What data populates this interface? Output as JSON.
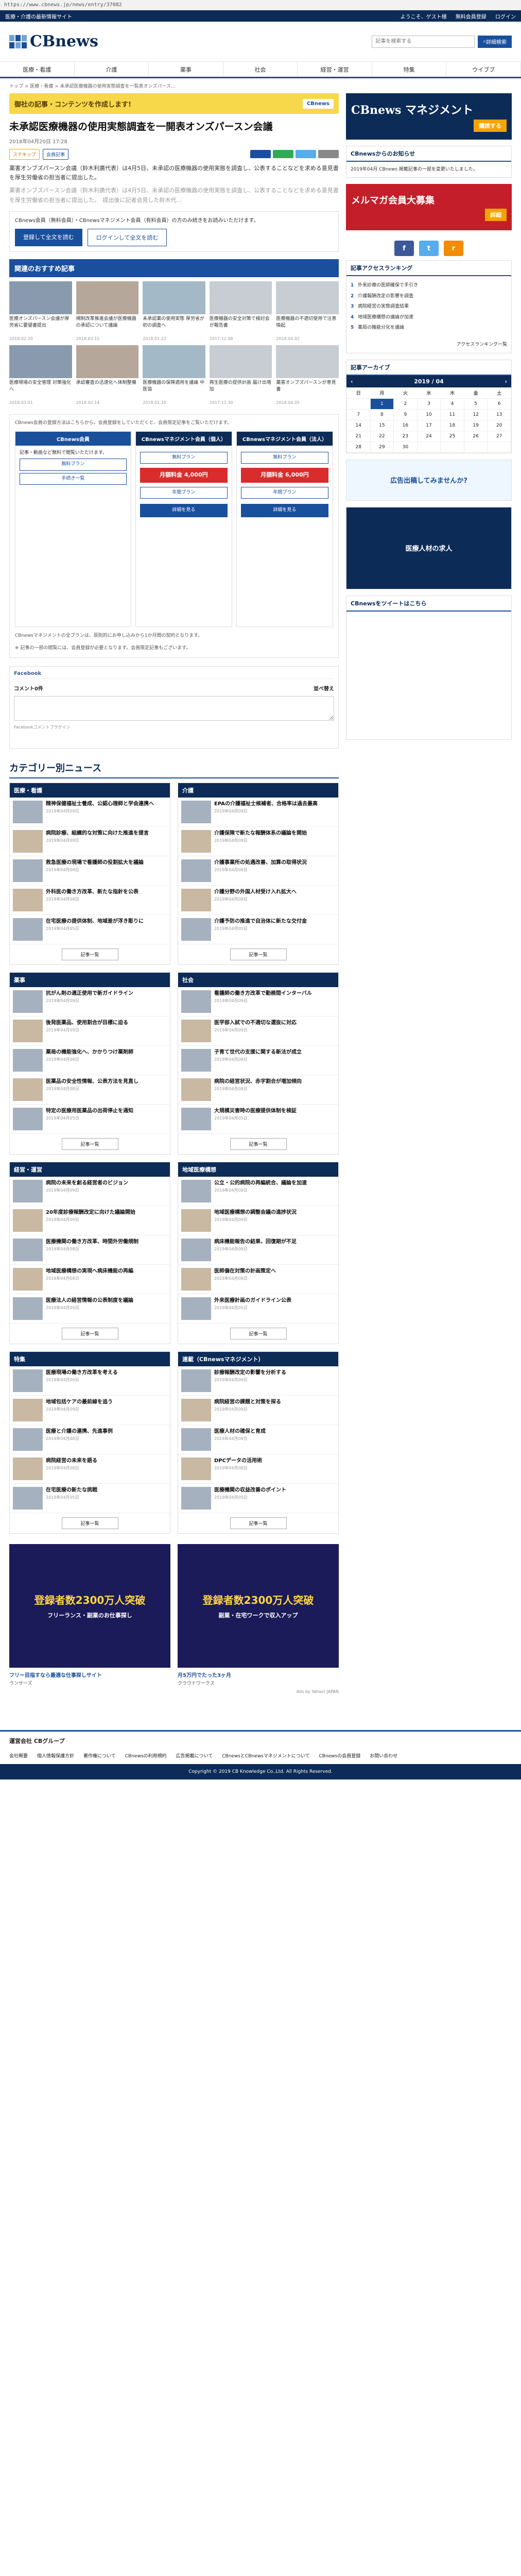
{
  "browser": {
    "url": "https://www.cbnews.jp/news/entry/37082"
  },
  "topbar": {
    "left": "医療・介護の最新情報サイト",
    "welcome": "ようこそ、ゲスト様",
    "links": [
      "無料会員登録",
      "ログイン"
    ]
  },
  "header": {
    "logo": "CBnews",
    "search_placeholder": "記事を検索する",
    "search_button": "詳細検索"
  },
  "nav": [
    "医療・看護",
    "介護",
    "薬事",
    "社会",
    "経営・運営",
    "特集",
    "ウイブブ"
  ],
  "breadcrumb": "トップ > 医療・看護 > 未承認医療機器の使用実態調査を一覧表オンズパース…",
  "article": {
    "promo": "御社の記事・コンテンツを作成します!",
    "promo_badge": "CBnews",
    "title": "未承認医療機器の使用実態調査を一開表オンズパースン会議",
    "date": "2018年04月20日 17:28",
    "tags": [
      "ステキップ",
      "会員記事"
    ],
    "lead1": "薬害オンブズパースン会議（鈴木利廣代表）は4月5日、未承認の医療機器の使用実態を調査し、公表することなどを求める意見書を厚生労働省の担当者に提出した。",
    "lead2": "薬害オンブズパースン会議（鈴木利廣代表）は4月5日、未承認の医療機器の使用実態を調査し、公表することなどを求める意見書を厚生労働省の担当者に提出した。　提出後に記者会見した鈴木代…",
    "login_note": "CBnews会員（無料会員）・CBnewsマネジメント会員（有料会員）の方のみ続きをお読みいただけます。",
    "login_btn1": "登録して全文を読む",
    "login_btn2": "ログインして全文を読む"
  },
  "reco": {
    "heading": "関連のおすすめ記事",
    "items": [
      {
        "cap": "医療オンズパースン会議が厚労省に要望書提出",
        "date": "2018.02.20"
      },
      {
        "cap": "規制改革推進会議が医療機器の承認について議論",
        "date": "2018.03.15"
      },
      {
        "cap": "未承認薬の使用実態 厚労省が初の調査へ",
        "date": "2018.01.22"
      },
      {
        "cap": "医療機器の安全対策で検討会が報告書",
        "date": "2017.12.08"
      },
      {
        "cap": "医療機器の不適切使用で注意喚起",
        "date": "2018.04.02"
      },
      {
        "cap": "医療現場の安全管理 対策強化へ",
        "date": "2018.03.01"
      },
      {
        "cap": "承認審査の迅速化へ体制整備",
        "date": "2018.02.14"
      },
      {
        "cap": "医療機器の保険適用を議論 中医協",
        "date": "2018.01.10"
      },
      {
        "cap": "再生医療の提供計画 届け出増加",
        "date": "2017.11.30"
      },
      {
        "cap": "薬害オンブズパースンが意見書",
        "date": "2018.04.05"
      }
    ]
  },
  "plans": {
    "note": "CBnews会員の登録方法はこちらから。会員登録をしていただくと、会員限定記事をご覧いただけます。",
    "col1": {
      "head": "CBnews会員",
      "body": "記事・動画など無料で閲覧いただけます。",
      "labels": [
        "無料プラン",
        "手続き一覧"
      ]
    },
    "col2": {
      "head": "CBnewsマネジメント会員（個人）",
      "price": "月額料金 4,000円",
      "labels": [
        "無料プラン",
        "年間プラン"
      ],
      "cta": "詳細を見る"
    },
    "col3": {
      "head": "CBnewsマネジメント会員（法人）",
      "price": "月額料金 6,000円",
      "labels": [
        "無料プラン",
        "年間プラン"
      ],
      "cta": "詳細を見る"
    },
    "disclaim1": "CBnewsマネジメントの全プランは、原則的にお申し込みから1か月間の契約となります。",
    "disclaim2": "※ 記事の一部の閲覧には、会員登録が必要となります。会員限定記事もございます。"
  },
  "facebook": {
    "label": "Facebook",
    "count": "コメント0件",
    "sort": "並べ替え",
    "plugin": "Facebookコメントプラグイン"
  },
  "categories": {
    "heading": "カテゴリー別ニュース",
    "more": "記事一覧",
    "boxes": [
      {
        "name": "医療・看護",
        "items": [
          {
            "t": "精神保健福祉士養成、公認心理師と学会連携へ",
            "d": "2019年04月09日"
          },
          {
            "t": "病院診療、組織的な対策に向けた推進を提言",
            "d": "2019年04月09日"
          },
          {
            "t": "救急医療の現場で看護師の役割拡大を議論",
            "d": "2019年04月08日"
          },
          {
            "t": "外科医の働き方改革、新たな指針を公表",
            "d": "2019年04月08日"
          },
          {
            "t": "在宅医療の提供体制、地域差が浮き彫りに",
            "d": "2019年04月05日"
          }
        ]
      },
      {
        "name": "介護",
        "items": [
          {
            "t": "EPAの介護福祉士候補者、合格率は過去最高",
            "d": "2019年04月09日"
          },
          {
            "t": "介護保険で新たな報酬体系の議論を開始",
            "d": "2019年04月09日"
          },
          {
            "t": "介護事業所の処遇改善、加算の取得状況",
            "d": "2019年04月08日"
          },
          {
            "t": "介護分野の外国人材受け入れ拡大へ",
            "d": "2019年04月08日"
          },
          {
            "t": "介護予防の推進で自治体に新たな交付金",
            "d": "2019年04月05日"
          }
        ]
      },
      {
        "name": "薬事",
        "items": [
          {
            "t": "抗がん剤の適正使用で新ガイドライン",
            "d": "2019年04月09日"
          },
          {
            "t": "後発医薬品、使用割合が目標に迫る",
            "d": "2019年04月09日"
          },
          {
            "t": "薬局の機能強化へ、かかりつけ薬剤師",
            "d": "2019年04月08日"
          },
          {
            "t": "医薬品の安全性情報、公表方法を見直し",
            "d": "2019年04月08日"
          },
          {
            "t": "特定の医療用医薬品の出荷停止を通知",
            "d": "2019年04月05日"
          }
        ]
      },
      {
        "name": "社会",
        "items": [
          {
            "t": "看護師の働き方改革で勤務間インターバル",
            "d": "2019年04月09日"
          },
          {
            "t": "医学部入試での不適切な選抜に対応",
            "d": "2019年04月09日"
          },
          {
            "t": "子育て世代の支援に関する新法が成立",
            "d": "2019年04月08日"
          },
          {
            "t": "病院の経営状況、赤字割合が増加傾向",
            "d": "2019年04月08日"
          },
          {
            "t": "大規模災害時の医療提供体制を検証",
            "d": "2019年04月05日"
          }
        ]
      },
      {
        "name": "経営・運営",
        "items": [
          {
            "t": "病院の未来を創る経営者のビジョン",
            "d": "2019年04月09日"
          },
          {
            "t": "20年度診療報酬改定に向けた議論開始",
            "d": "2019年04月09日"
          },
          {
            "t": "医療機関の働き方改革、時間外労働規制",
            "d": "2019年04月08日"
          },
          {
            "t": "地域医療構想の実現へ病床機能の再編",
            "d": "2019年04月08日"
          },
          {
            "t": "医療法人の経営情報の公表制度を議論",
            "d": "2019年04月05日"
          }
        ]
      },
      {
        "name": "地域医療構想",
        "items": [
          {
            "t": "公立・公的病院の再編統合、議論を加速",
            "d": "2019年04月09日"
          },
          {
            "t": "地域医療構想の調整会議の進捗状況",
            "d": "2019年04月09日"
          },
          {
            "t": "病床機能報告の結果、回復期が不足",
            "d": "2019年04月08日"
          },
          {
            "t": "医師偏在対策の計画策定へ",
            "d": "2019年04月08日"
          },
          {
            "t": "外来医療計画のガイドライン公表",
            "d": "2019年04月05日"
          }
        ]
      },
      {
        "name": "特集",
        "items": [
          {
            "t": "医療現場の働き方改革を考える",
            "d": "2019年04月09日"
          },
          {
            "t": "地域包括ケアの最前線を追う",
            "d": "2019年04月09日"
          },
          {
            "t": "医療と介護の連携、先進事例",
            "d": "2019年04月08日"
          },
          {
            "t": "病院経営の未来を語る",
            "d": "2019年04月08日"
          },
          {
            "t": "在宅医療の新たな挑戦",
            "d": "2019年04月05日"
          }
        ]
      },
      {
        "name": "連載（CBnewsマネジメント）",
        "items": [
          {
            "t": "診療報酬改定の影響を分析する",
            "d": "2019年04月09日"
          },
          {
            "t": "病院経営の課題と対策を探る",
            "d": "2019年04月09日"
          },
          {
            "t": "医療人材の確保と育成",
            "d": "2019年04月08日"
          },
          {
            "t": "DPCデータの活用術",
            "d": "2019年04月08日"
          },
          {
            "t": "医療機関の収益改善のポイント",
            "d": "2019年04月05日"
          }
        ]
      }
    ]
  },
  "ads": [
    {
      "title": "登録者数2300万人突破",
      "sub": "フリーランス・副業のお仕事探し",
      "cap": "フリー目指すなら最適な仕事探しサイト",
      "cap2": "ランサーズ"
    },
    {
      "title": "登録者数2300万人突破",
      "sub": "副業・在宅ワークで収入アップ",
      "cap": "月5万円でたった3ヶ月",
      "cap2": "クラウドワークス"
    }
  ],
  "ad_by": "Ads by Yahoo! JAPAN",
  "sidebar": {
    "banner1": {
      "big": "CBnews マネジメント",
      "btn": "購読する"
    },
    "notice_head": "CBnewsからのお知らせ",
    "notice": "2019年04月 CBnews 掲載記事の一部を変更いたしました。",
    "banner2": {
      "big": "メルマガ会員大募集",
      "btn": "詳細"
    },
    "social": [
      "f",
      "t",
      "r"
    ],
    "rank_head": "記事アクセスランキング",
    "rank": [
      "外来診療の医師確保で手引き",
      "介護報酬改定の影響を調査",
      "病院経営の実態調査結果",
      "地域医療構想の議論が加速",
      "薬局の機能分化を議論"
    ],
    "rank_more": "アクセスランキング一覧",
    "cal_head": "記事アーカイブ",
    "cal_title": "2019 / 04",
    "cal_week": [
      "日",
      "月",
      "火",
      "水",
      "木",
      "金",
      "土"
    ],
    "cal_rows": [
      [
        "",
        "1",
        "2",
        "3",
        "4",
        "5",
        "6"
      ],
      [
        "7",
        "8",
        "9",
        "10",
        "11",
        "12",
        "13"
      ],
      [
        "14",
        "15",
        "16",
        "17",
        "18",
        "19",
        "20"
      ],
      [
        "21",
        "22",
        "23",
        "24",
        "25",
        "26",
        "27"
      ],
      [
        "28",
        "29",
        "30",
        "",
        "",
        "",
        ""
      ]
    ],
    "ad1": "広告出稿してみませんか?",
    "ad2": "医療人材の求人",
    "tw_head": "CBnewsをツイートはこちら"
  },
  "footer": {
    "company": "運営会社 CBグループ",
    "links": [
      "会社概要",
      "個人情報保護方針",
      "著作権について",
      "CBnewsの利用規約",
      "広告掲載について",
      "CBnewsとCBnewsマネジメントについて",
      "CBnewsの会員登録",
      "お問い合わせ"
    ],
    "copy": "Copyright © 2019 CB Knowledge Co.,Ltd. All Rights Reserved."
  }
}
